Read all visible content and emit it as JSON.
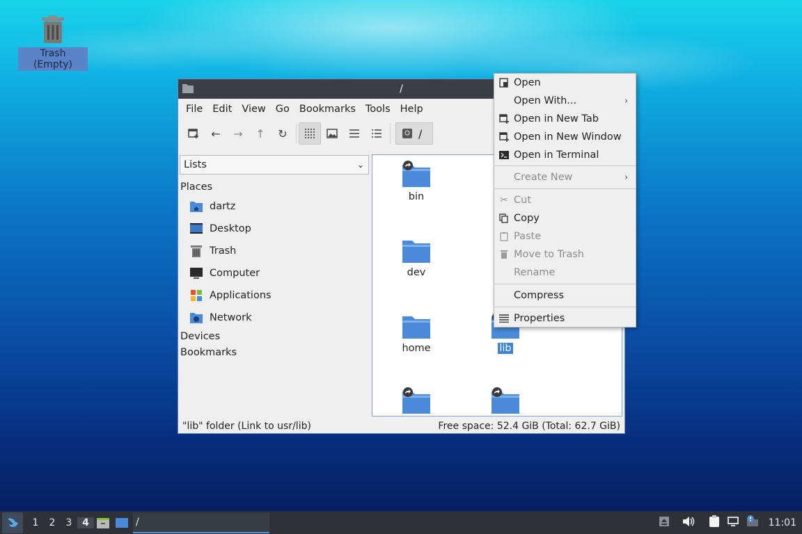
{
  "desktop": {
    "trash_label": "Trash (Empty)"
  },
  "window": {
    "title": "/",
    "menu": [
      "File",
      "Edit",
      "View",
      "Go",
      "Bookmarks",
      "Tools",
      "Help"
    ],
    "path_label": "/",
    "sidebar": {
      "combo_value": "Lists",
      "places_header": "Places",
      "places": [
        "dartz",
        "Desktop",
        "Trash",
        "Computer",
        "Applications",
        "Network"
      ],
      "devices_header": "Devices",
      "bookmarks_header": "Bookmarks"
    },
    "files": [
      {
        "name": "bin"
      },
      {
        "name": "dev"
      },
      {
        "name": "home"
      },
      {
        "name": "lib"
      }
    ],
    "status_left": "\"lib\" folder (Link to usr/lib)",
    "status_right": "Free space: 52.4 GiB (Total: 62.7 GiB)"
  },
  "context_menu": {
    "open": "Open",
    "open_with": "Open With...",
    "open_new_tab": "Open in New Tab",
    "open_new_window": "Open in New Window",
    "open_terminal": "Open in Terminal",
    "create_new": "Create New",
    "cut": "Cut",
    "copy": "Copy",
    "paste": "Paste",
    "move_to_trash": "Move to Trash",
    "rename": "Rename",
    "compress": "Compress",
    "properties": "Properties"
  },
  "taskbar": {
    "workspaces": [
      "1",
      "2",
      "3",
      "4"
    ],
    "active_workspace": "4",
    "task_label": "/",
    "clock": "11:01"
  },
  "colors": {
    "folder": "#4a8ad8",
    "selection": "#3d82d8",
    "titlebar": "#3b3f45",
    "taskbar": "#2e3238"
  }
}
